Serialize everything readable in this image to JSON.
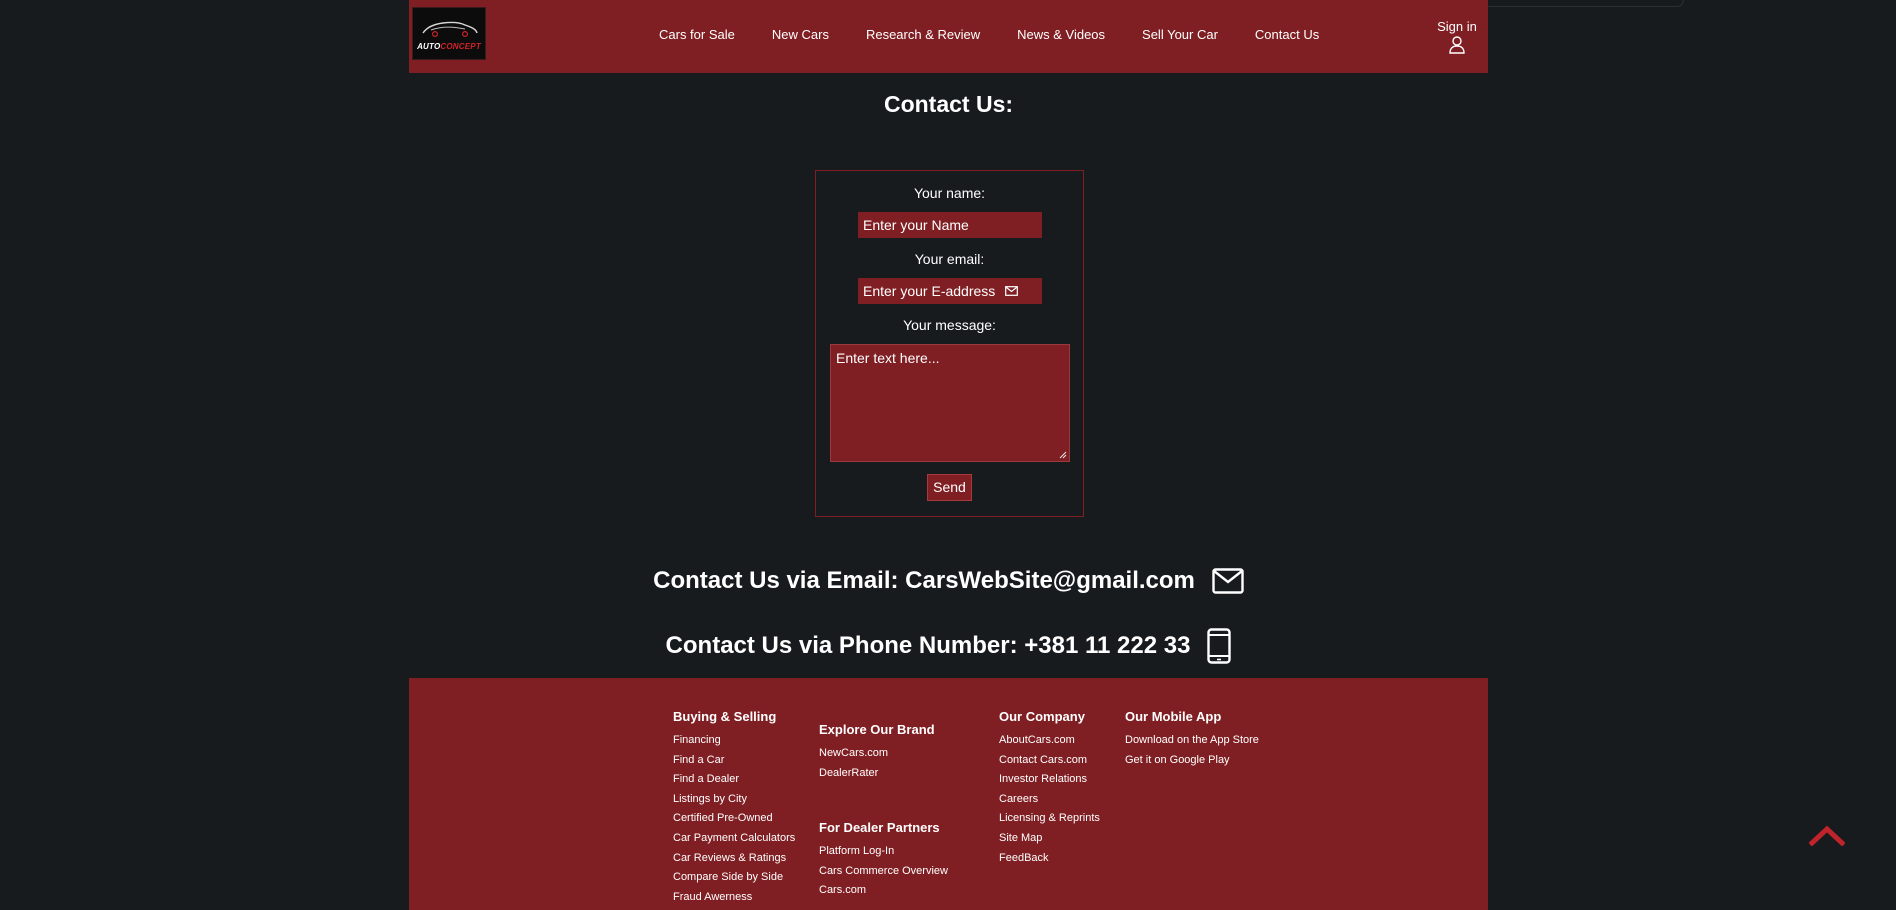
{
  "header": {
    "logo": {
      "word1": "AUTO",
      "word2": "CONCEPT"
    },
    "nav": [
      "Cars for Sale",
      "New Cars",
      "Research & Review",
      "News & Videos",
      "Sell Your Car",
      "Contact Us"
    ],
    "signin_label": "Sign in",
    "signin_icon": "user-icon"
  },
  "page_title": "Contact Us:",
  "form": {
    "name_label": "Your name:",
    "name_placeholder": "Enter your Name",
    "email_label": "Your email:",
    "email_placeholder": "Enter your E-address",
    "message_label": "Your message:",
    "message_placeholder": "Enter text here...",
    "send_label": "Send"
  },
  "contact": {
    "email_text": "Contact Us via Email: CarsWebSite@gmail.com",
    "email_icon": "envelope-icon",
    "phone_text": "Contact Us via Phone Number: +381 11 222 33",
    "phone_icon": "phone-icon"
  },
  "footer": {
    "buying": {
      "title": "Buying & Selling",
      "links": [
        "Financing",
        "Find a Car",
        "Find a Dealer",
        "Listings by City",
        "Certified Pre-Owned",
        "Car Payment Calculators",
        "Car Reviews & Ratings",
        "Compare Side by Side",
        "Fraud Awerness"
      ]
    },
    "explore": {
      "title": "Explore Our Brand",
      "links": [
        "NewCars.com",
        "DealerRater"
      ]
    },
    "dealer": {
      "title": "For Dealer Partners",
      "links": [
        "Platform Log-In",
        "Cars Commerce Overview",
        "Cars.com"
      ]
    },
    "company": {
      "title": "Our Company",
      "links": [
        "AboutCars.com",
        "Contact Cars.com",
        "Investor Relations",
        "Careers",
        "Licensing & Reprints",
        "Site Map",
        "FeedBack"
      ]
    },
    "app": {
      "title": "Our Mobile App",
      "links": [
        "Download on the App Store",
        "Get it on Google Play"
      ]
    }
  },
  "scroll_top_icon": "chevron-up-icon",
  "colors": {
    "brand_red": "#801f23",
    "background": "#171b1e",
    "accent_red": "#c0242a"
  }
}
